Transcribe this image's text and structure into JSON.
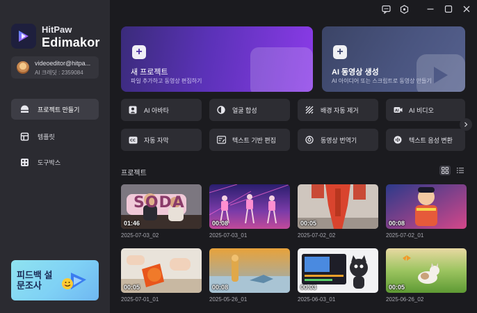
{
  "app": {
    "brand_line1": "HitPaw",
    "brand_line2": "Edimakor"
  },
  "user": {
    "email": "videoeditor@hitpa...",
    "credit": "AI 크레딧 : 2359084"
  },
  "sidebar": {
    "items": [
      {
        "label": "프로젝트 만들기",
        "icon": "create-project-icon"
      },
      {
        "label": "템플릿",
        "icon": "template-icon"
      },
      {
        "label": "도구박스",
        "icon": "toolbox-icon"
      }
    ],
    "banner": {
      "text": "피드백 설문조사"
    }
  },
  "hero": {
    "new_project": {
      "title": "새 프로젝트",
      "subtitle": "파일 추가하고 동영상 편집하기"
    },
    "ai_video": {
      "title": "AI 동영상 생성",
      "subtitle": "AI 아이디어 또는 스크립트로 동영상 만들기"
    }
  },
  "tools": [
    {
      "label": "AI 아바타",
      "icon": "avatar-icon"
    },
    {
      "label": "얼굴 합성",
      "icon": "face-swap-icon"
    },
    {
      "label": "배경 자동 제거",
      "icon": "background-remove-icon"
    },
    {
      "label": "AI 비디오",
      "icon": "ai-video-icon"
    },
    {
      "label": "자동 자막",
      "icon": "caption-icon"
    },
    {
      "label": "텍스트 기반 편집",
      "icon": "text-edit-icon"
    },
    {
      "label": "동영상 번역기",
      "icon": "translate-icon"
    },
    {
      "label": "텍스트 음성 변환",
      "icon": "tts-icon"
    }
  ],
  "projects_section": {
    "title": "프로젝트"
  },
  "projects": [
    {
      "duration": "01:46",
      "date": "2025-07-03_02",
      "thumb_text": "SODA"
    },
    {
      "duration": "00:08",
      "date": "2025-07-03_01"
    },
    {
      "duration": "00:05",
      "date": "2025-07-02_02"
    },
    {
      "duration": "00:08",
      "date": "2025-07-02_01"
    },
    {
      "duration": "00:05",
      "date": "2025-07-01_01"
    },
    {
      "duration": "00:08",
      "date": "2025-05-26_01"
    },
    {
      "duration": "00:03",
      "date": "2025-06-03_01"
    },
    {
      "duration": "00:05",
      "date": "2025-06-26_02"
    }
  ],
  "colors": {
    "background": "#1b1b1f",
    "sidebar": "#2b2b31",
    "accent_purple": "#8b3be8",
    "card": "#2d2d33"
  }
}
